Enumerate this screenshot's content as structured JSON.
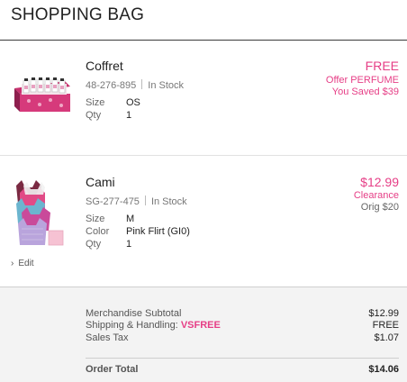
{
  "page": {
    "title": "SHOPPING BAG"
  },
  "items": [
    {
      "name": "Coffret",
      "sku": "48-276-895",
      "stock": "In Stock",
      "details": [
        {
          "label": "Size",
          "value": "OS"
        },
        {
          "label": "Qty",
          "value": "1"
        }
      ],
      "price": "FREE",
      "price_note_1": "Offer PERFUME",
      "price_note_2": "You Saved $39",
      "image_icon": "perfume-gift-set"
    },
    {
      "name": "Cami",
      "sku": "SG-277-475",
      "stock": "In Stock",
      "details": [
        {
          "label": "Size",
          "value": "M"
        },
        {
          "label": "Color",
          "value": "Pink Flirt (GI0)"
        },
        {
          "label": "Qty",
          "value": "1"
        }
      ],
      "price": "$12.99",
      "price_note_1": "Clearance",
      "price_note_2": "Orig $20",
      "edit_label": "Edit",
      "image_icon": "camisole-stack"
    }
  ],
  "summary": {
    "merchandise_label": "Merchandise Subtotal",
    "merchandise_value": "$12.99",
    "shipping_label": "Shipping & Handling:",
    "shipping_code": "VSFREE",
    "shipping_value": "FREE",
    "tax_label": "Sales Tax",
    "tax_value": "$1.07",
    "total_label": "Order Total",
    "total_value": "$14.06"
  },
  "colors": {
    "accent_pink": "#e63e86",
    "text_dark": "#222222",
    "text_muted": "#777777",
    "summary_bg": "#f3f3f3"
  }
}
